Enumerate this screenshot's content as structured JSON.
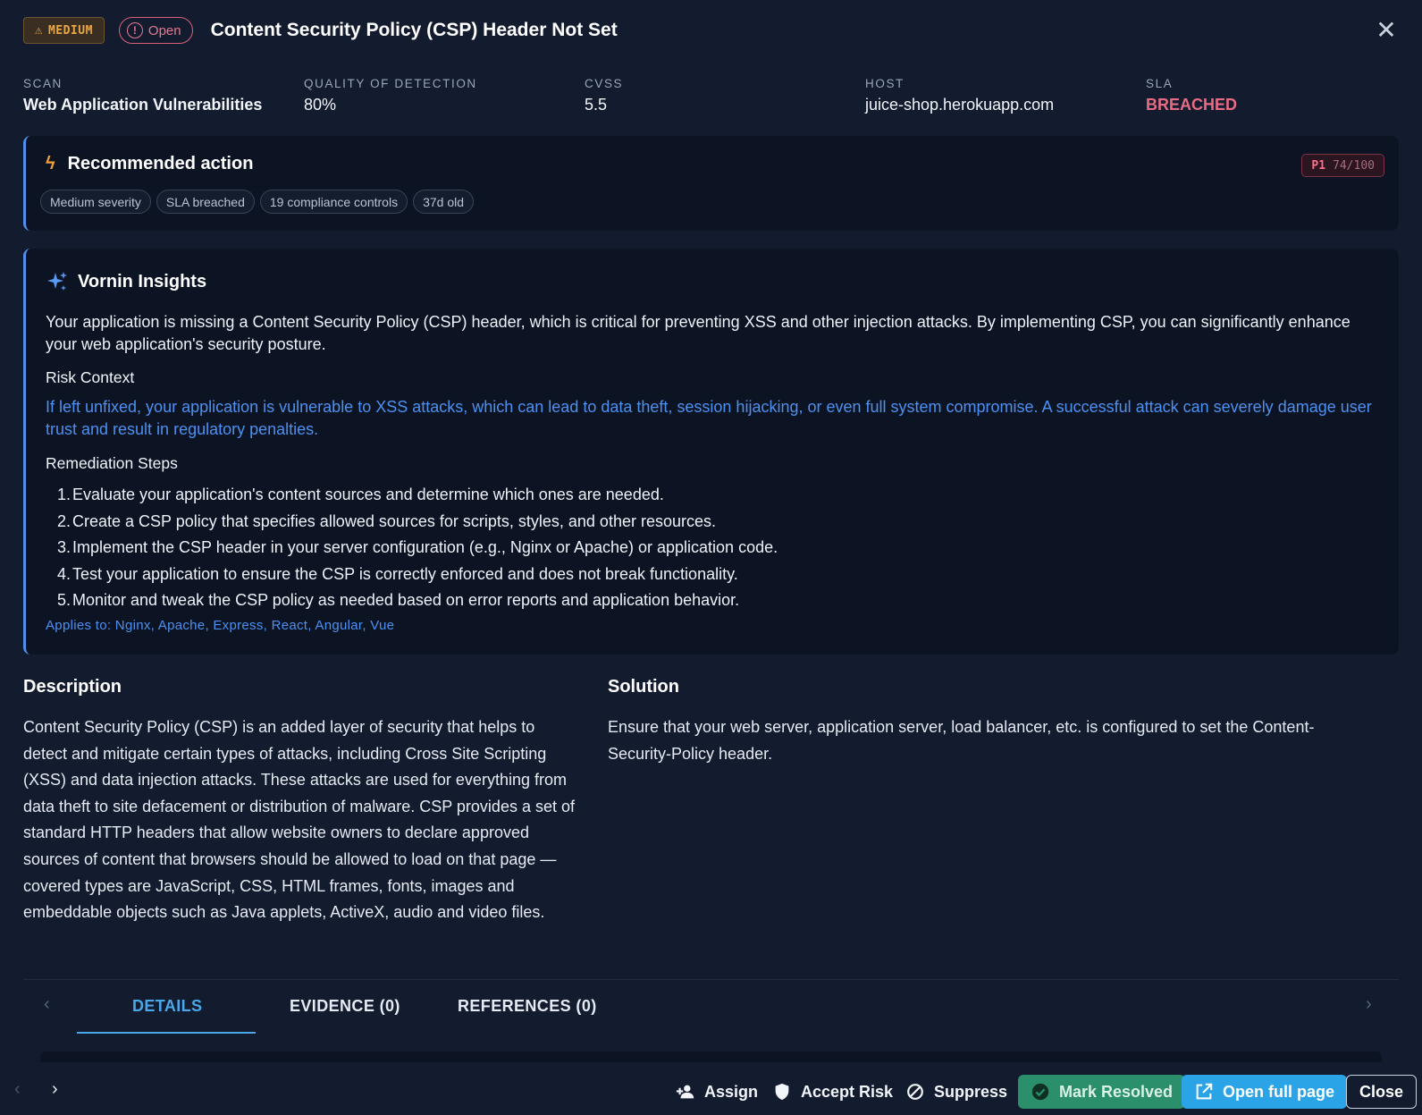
{
  "header": {
    "severity": "MEDIUM",
    "status": "Open",
    "title": "Content Security Policy (CSP) Header Not Set"
  },
  "meta": [
    {
      "label": "SCAN",
      "value": "Web Application Vulnerabilities"
    },
    {
      "label": "QUALITY OF DETECTION",
      "value": "80%"
    },
    {
      "label": "CVSS",
      "value": "5.5"
    },
    {
      "label": "HOST",
      "value": "juice-shop.herokuapp.com"
    },
    {
      "label": "SLA",
      "value": "BREACHED"
    }
  ],
  "recommended": {
    "title": "Recommended action",
    "priority": "P1",
    "score": "74/100",
    "chips": [
      "Medium severity",
      "SLA breached",
      "19 compliance controls",
      "37d old"
    ]
  },
  "insights": {
    "title": "Vornin Insights",
    "summary": "Your application is missing a Content Security Policy (CSP) header, which is critical for preventing XSS and other injection attacks. By implementing CSP, you can significantly enhance your web application's security posture.",
    "risk_heading": "Risk Context",
    "risk_text": "If left unfixed, your application is vulnerable to XSS attacks, which can lead to data theft, session hijacking, or even full system compromise. A successful attack can severely damage user trust and result in regulatory penalties.",
    "steps_heading": "Remediation Steps",
    "steps": [
      "Evaluate your application's content sources and determine which ones are needed.",
      "Create a CSP policy that specifies allowed sources for scripts, styles, and other resources.",
      "Implement the CSP header in your server configuration (e.g., Nginx or Apache) or application code.",
      "Test your application to ensure the CSP is correctly enforced and does not break functionality.",
      "Monitor and tweak the CSP policy as needed based on error reports and application behavior."
    ],
    "applies_to": "Applies to: Nginx, Apache, Express, React, Angular, Vue"
  },
  "description": {
    "heading": "Description",
    "text": "Content Security Policy (CSP) is an added layer of security that helps to detect and mitigate certain types of attacks, including Cross Site Scripting (XSS) and data injection attacks. These attacks are used for everything from data theft to site defacement or distribution of malware. CSP provides a set of standard HTTP headers that allow website owners to declare approved sources of content that browsers should be allowed to load on that page — covered types are JavaScript, CSS, HTML frames, fonts, images and embeddable objects such as Java applets, ActiveX, audio and video files."
  },
  "solution": {
    "heading": "Solution",
    "text": "Ensure that your web server, application server, load balancer, etc. is configured to set the Content-Security-Policy header."
  },
  "tabs": [
    {
      "label": "DETAILS",
      "active": true
    },
    {
      "label": "EVIDENCE (0)",
      "active": false
    },
    {
      "label": "REFERENCES (0)",
      "active": false
    }
  ],
  "footer": {
    "assign": "Assign",
    "accept_risk": "Accept Risk",
    "suppress": "Suppress",
    "mark_resolved": "Mark Resolved",
    "open_full_page": "Open full page",
    "close": "Close"
  },
  "colors": {
    "background": "#131b2e",
    "card": "#0c1424",
    "accent_blue": "#4d90f0",
    "tab_active": "#4aa8ea",
    "breached": "#e86b84",
    "severity_medium": "#e8a74a",
    "resolved_green": "#2a8f6a",
    "open_page_blue": "#2aa4e6"
  }
}
